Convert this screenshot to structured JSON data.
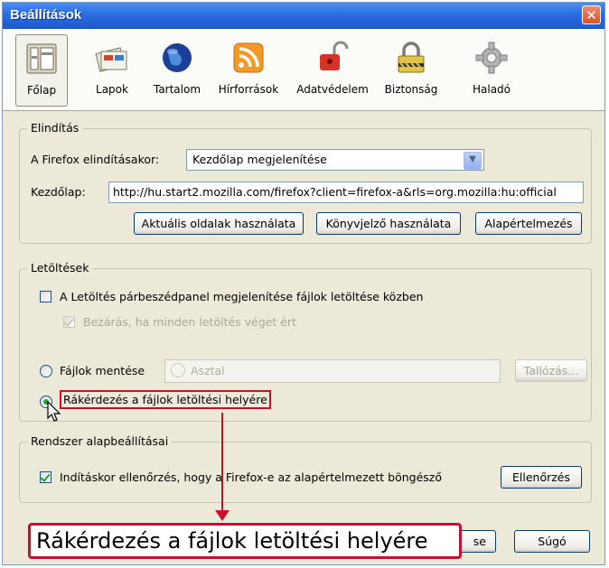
{
  "window": {
    "title": "Beállítások",
    "close_label": "✕"
  },
  "toolbar": {
    "items": [
      {
        "label": "Főlap",
        "icon": "main-icon"
      },
      {
        "label": "Lapok",
        "icon": "tabs-icon"
      },
      {
        "label": "Tartalom",
        "icon": "content-icon"
      },
      {
        "label": "Hírforrások",
        "icon": "feeds-icon"
      },
      {
        "label": "Adatvédelem",
        "icon": "privacy-icon"
      },
      {
        "label": "Biztonság",
        "icon": "security-icon"
      },
      {
        "label": "Haladó",
        "icon": "advanced-icon"
      }
    ],
    "selected": "Főlap"
  },
  "startup": {
    "group_title": "Elindítás",
    "when_label": "A Firefox elindításakor:",
    "when_value": "Kezdőlap megjelenítése",
    "home_label": "Kezdőlap:",
    "home_value": "http://hu.start2.mozilla.com/firefox?client=firefox-a&rls=org.mozilla:hu:official",
    "btn_current": "Aktuális oldalak használata",
    "btn_bookmark": "Könyvjelző használata",
    "btn_default": "Alapértelmezés"
  },
  "downloads": {
    "group_title": "Letöltések",
    "show_window_label": "A Letöltés párbeszédpanel megjelenítése fájlok letöltése közben",
    "close_when_done_label": "Bezárás, ha minden letöltés véget ért",
    "save_files_label": "Fájlok mentése",
    "save_folder": "Asztal",
    "browse_label": "Tallózás...",
    "ask_label": "Rákérdezés a fájlok letöltési helyére"
  },
  "system": {
    "group_title": "Rendszer alapbeállításai",
    "check_default_label": "Indításkor ellenőrzés, hogy a Firefox-e az alapértelmezett böngésző",
    "check_now": "Ellenőrzés"
  },
  "footer": {
    "close_partial": "se",
    "help": "Súgó"
  },
  "callout": {
    "text": "Rákérdezés a fájlok letöltési helyére",
    "color": "#c8102e"
  }
}
